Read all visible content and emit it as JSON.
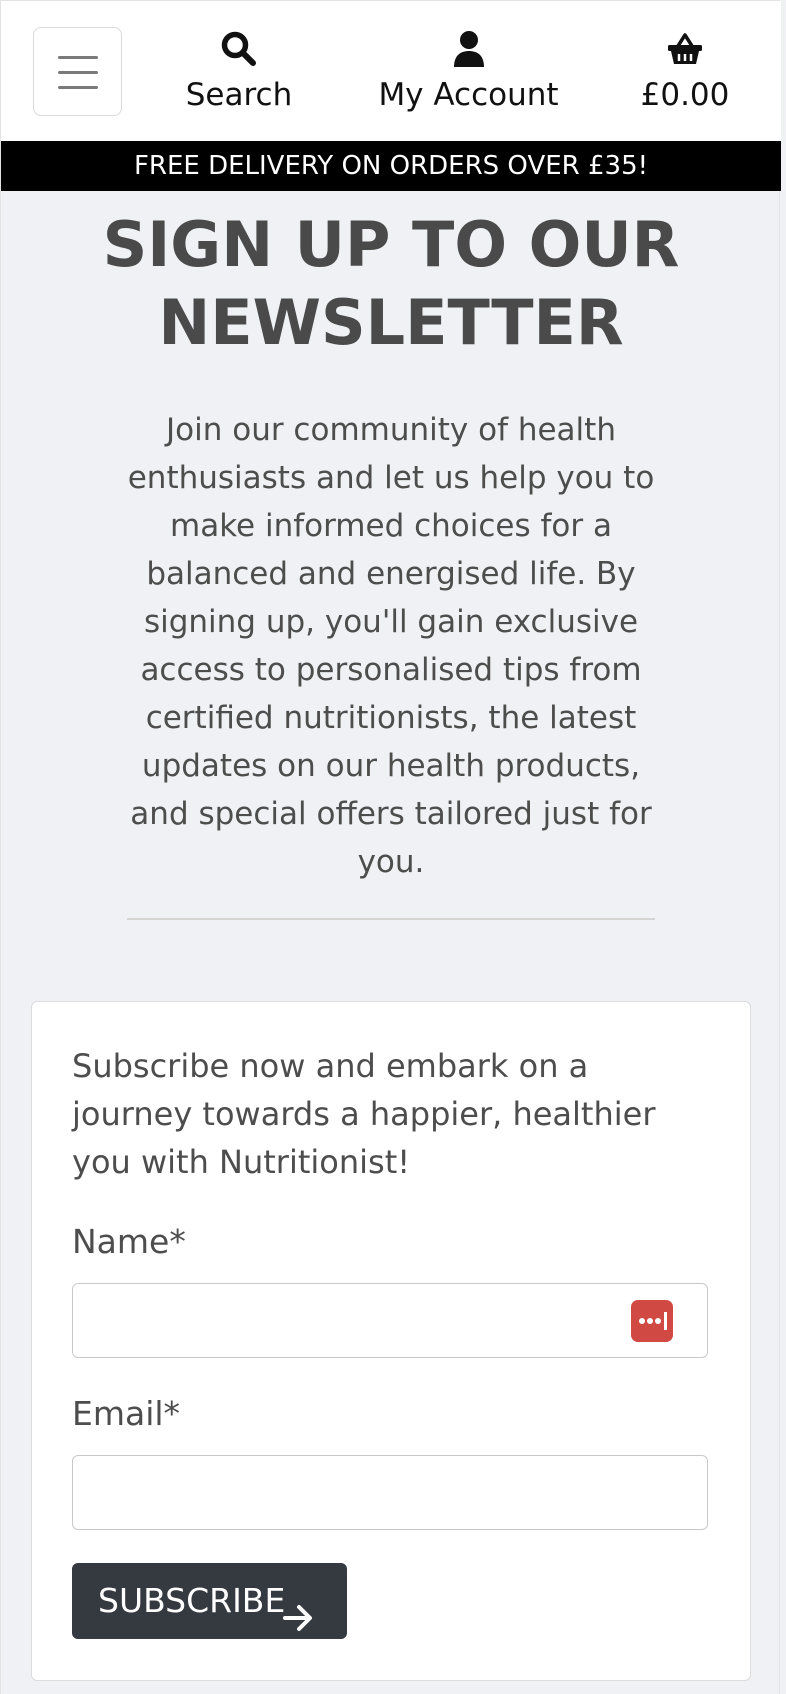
{
  "header": {
    "menu_icon": "hamburger-icon",
    "search": {
      "icon": "search-icon",
      "label": "Search"
    },
    "account": {
      "icon": "user-icon",
      "label": "My Account"
    },
    "basket": {
      "icon": "basket-icon",
      "total": "£0.00"
    }
  },
  "banner": {
    "text": "FREE DELIVERY ON ORDERS OVER £35!"
  },
  "newsletter": {
    "heading_line1": "SIGN UP TO OUR",
    "heading_line2": "NEWSLETTER",
    "intro": "Join our community of health enthusiasts and let us help you to make informed choices for a balanced and energised life. By signing up, you'll gain exclusive access to personalised tips from certified nutritionists, the latest updates on our health products, and special offers tailored just for you."
  },
  "form": {
    "lead": "Subscribe now and embark on a journey towards a happier, healthier you with Nutritionist!",
    "name_label": "Name*",
    "name_value": "",
    "email_label": "Email*",
    "email_value": "",
    "subscribe_label": "SUBSCRIBE",
    "subscribe_icon": "arrow-right-icon",
    "autofill_icon": "password-manager-icon"
  },
  "colors": {
    "banner_bg": "#000000",
    "page_bg": "#f0f1f5",
    "button_bg": "#343a40",
    "autofill_icon_bg": "#d04a43"
  }
}
